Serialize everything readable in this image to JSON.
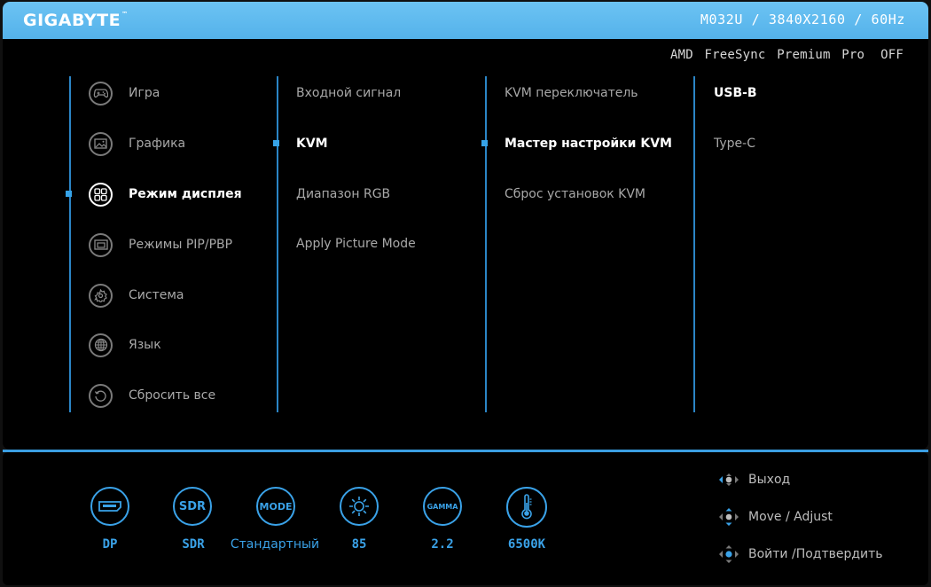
{
  "header": {
    "brand": "GIGABYTE",
    "trademark": "™",
    "model_info": "M032U / 3840X2160 / 60Hz",
    "freesync_label": "AMD FreeSync Premium Pro",
    "freesync_value": "OFF"
  },
  "main_menu": [
    {
      "label": "Игра",
      "icon": "gamepad-icon"
    },
    {
      "label": "Графика",
      "icon": "picture-icon"
    },
    {
      "label": "Режим дисплея",
      "icon": "display-grid-icon",
      "active": true
    },
    {
      "label": "Режимы PIP/PBP",
      "icon": "pip-icon"
    },
    {
      "label": "Система",
      "icon": "gear-icon"
    },
    {
      "label": "Язык",
      "icon": "globe-icon"
    },
    {
      "label": "Сбросить все",
      "icon": "reset-icon"
    }
  ],
  "sub_menu_1": [
    {
      "label": "Входной сигнал"
    },
    {
      "label": "KVM",
      "active": true
    },
    {
      "label": "Диапазон RGB"
    },
    {
      "label": "Apply Picture Mode"
    }
  ],
  "sub_menu_2": [
    {
      "label": "KVM переключатель"
    },
    {
      "label": "Мастер настройки KVM",
      "active": true
    },
    {
      "label": "Сброс установок KVM"
    }
  ],
  "sub_menu_3": [
    {
      "label": "USB-B",
      "active": true
    },
    {
      "label": "Type-C"
    }
  ],
  "status": [
    {
      "icon_text": "",
      "value": "DP",
      "icon": "displayport-icon"
    },
    {
      "icon_text": "SDR",
      "value": "SDR",
      "icon": "sdr-icon"
    },
    {
      "icon_text": "MODE",
      "value": "Стандартный",
      "icon": "mode-icon"
    },
    {
      "icon_text": "",
      "value": "85",
      "icon": "brightness-icon"
    },
    {
      "icon_text": "GAMMA",
      "value": "2.2",
      "icon": "gamma-icon"
    },
    {
      "icon_text": "",
      "value": "6500K",
      "icon": "thermometer-icon"
    }
  ],
  "hints": [
    {
      "label": "Выход",
      "icon": "joystick-left-icon"
    },
    {
      "label": "Move / Adjust",
      "icon": "joystick-updown-icon"
    },
    {
      "label": "Войти /Подтвердить",
      "icon": "joystick-press-icon"
    }
  ],
  "colors": {
    "accent": "#36a3e8",
    "header_bg": "#5cb8ee",
    "background": "#000000"
  }
}
